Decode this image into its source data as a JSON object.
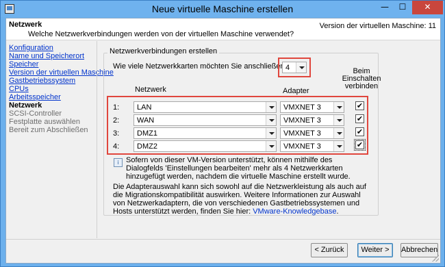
{
  "window": {
    "title": "Neue virtuelle Maschine erstellen",
    "minimize_glyph": "—",
    "maximize_glyph": "☐",
    "close_glyph": "✕"
  },
  "header": {
    "title": "Netzwerk",
    "subtitle": "Welche Netzwerkverbindungen werden von der virtuellen Maschine verwendet?",
    "version": "Version der virtuellen Maschine: 11"
  },
  "steps": [
    {
      "label": "Konfiguration",
      "state": "link"
    },
    {
      "label": "Name und Speicherort",
      "state": "link"
    },
    {
      "label": "Speicher",
      "state": "link"
    },
    {
      "label": "Version der virtuellen Maschine",
      "state": "link"
    },
    {
      "label": "Gastbetriebssystem",
      "state": "link"
    },
    {
      "label": "CPUs",
      "state": "link"
    },
    {
      "label": "Arbeitsspeicher",
      "state": "link"
    },
    {
      "label": "Netzwerk",
      "state": "current"
    },
    {
      "label": "SCSI-Controller",
      "state": "future"
    },
    {
      "label": "Festplatte auswählen",
      "state": "future"
    },
    {
      "label": "Bereit zum Abschließen",
      "state": "future"
    }
  ],
  "group": {
    "legend": "Netzwerkverbindungen erstellen",
    "question": "Wie viele Netzwerkkarten möchten Sie anschließen?",
    "nic_count": "4",
    "col_network": "Netzwerk",
    "col_adapter": "Adapter",
    "col_connect_line1": "Beim",
    "col_connect_line2": "Einschalten",
    "col_connect_line3": "verbinden"
  },
  "nics": [
    {
      "label": "1:",
      "network": "LAN",
      "adapter": "VMXNET 3",
      "connect": "✔"
    },
    {
      "label": "2:",
      "network": "WAN",
      "adapter": "VMXNET 3",
      "connect": "✔"
    },
    {
      "label": "3:",
      "network": "DMZ1",
      "adapter": "VMXNET 3",
      "connect": "✔"
    },
    {
      "label": "4:",
      "network": "DMZ2",
      "adapter": "VMXNET 3",
      "connect": "✔"
    }
  ],
  "info": {
    "icon": "info-icon",
    "text": "Sofern von dieser VM-Version unterstützt, können mithilfe des Dialogfelds 'Einstellungen bearbeiten' mehr als 4 Netzwerkkarten hinzugefügt werden, nachdem die virtuelle Maschine erstellt wurde."
  },
  "adapter_info": {
    "text": "Die Adapterauswahl kann sich sowohl auf die Netzwerkleistung als auch auf die Migrationskompatibilität auswirken. Weitere Informationen zur Auswahl von Netzwerkadaptern, die von verschiedenen Gastbetriebssystemen und Hosts unterstützt werden, finden Sie hier: ",
    "link": "VMware-Knowledgebase",
    "suffix": "."
  },
  "buttons": {
    "back": "< Zurück",
    "next": "Weiter >",
    "cancel": "Abbrechen"
  },
  "colors": {
    "titlebar": "#6fb2ee",
    "highlight": "#e0463d",
    "link": "#0033cc"
  }
}
